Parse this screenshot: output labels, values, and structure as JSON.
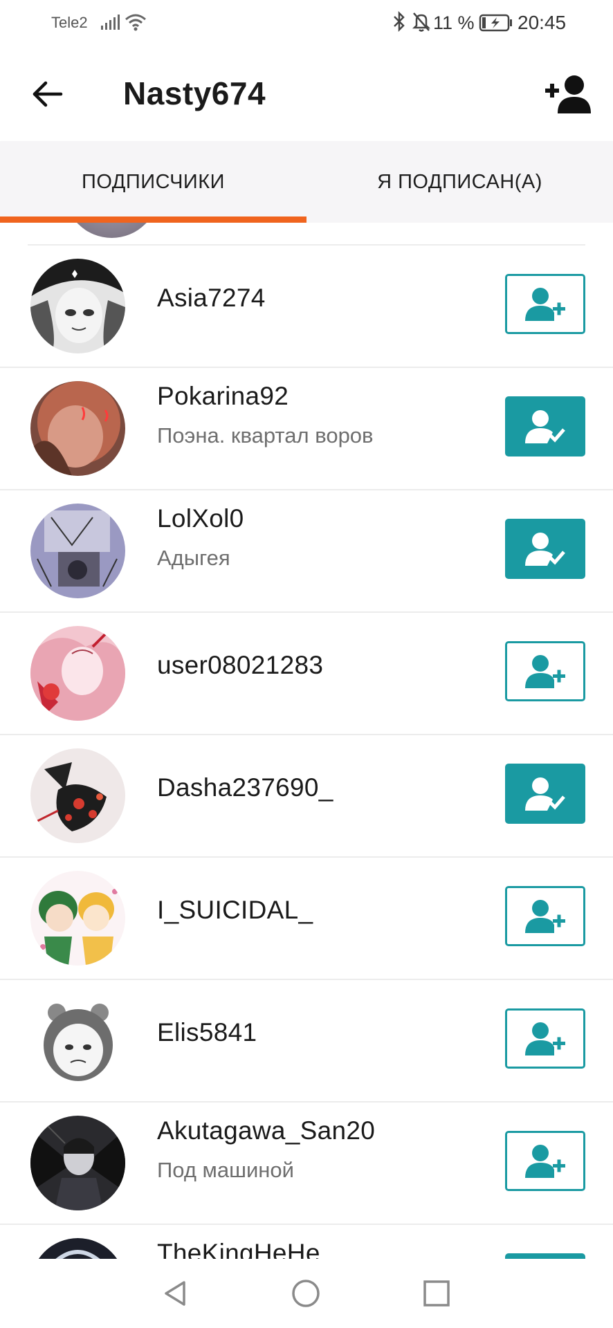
{
  "status_bar": {
    "carrier": "Tele2",
    "battery": "11 %",
    "time": "20:45",
    "icons": [
      "signal-icon",
      "wifi-icon",
      "bluetooth-icon",
      "bell-off-icon",
      "battery-charging-icon"
    ]
  },
  "app_bar": {
    "title": "Nasty674",
    "back_icon": "arrow-left-icon",
    "action_icon": "add-user-icon"
  },
  "tabs": [
    {
      "label": "ПОДПИСЧИКИ",
      "active": true
    },
    {
      "label": "Я ПОДПИСАН(А)",
      "active": false
    }
  ],
  "colors": {
    "accent_tab": "#f0641e",
    "follow_teal": "#1a9aa2"
  },
  "followers": [
    {
      "username": "Asia7274",
      "location": "",
      "following": false
    },
    {
      "username": "Pokarina92",
      "location": "Поэна. квартал воров",
      "following": true
    },
    {
      "username": "LolXol0",
      "location": "Адыгея",
      "following": true
    },
    {
      "username": "user08021283",
      "location": "",
      "following": false
    },
    {
      "username": "Dasha237690_",
      "location": "",
      "following": true
    },
    {
      "username": "I_SUICIDAL_",
      "location": "",
      "following": false
    },
    {
      "username": "Elis5841",
      "location": "",
      "following": false
    },
    {
      "username": "Akutagawa_San20",
      "location": "Под машиной",
      "following": false
    },
    {
      "username": "TheKingHeHe",
      "location": "",
      "following": true
    }
  ],
  "nav_bar": {
    "icons": [
      "nav-back-icon",
      "nav-home-icon",
      "nav-recents-icon"
    ]
  }
}
